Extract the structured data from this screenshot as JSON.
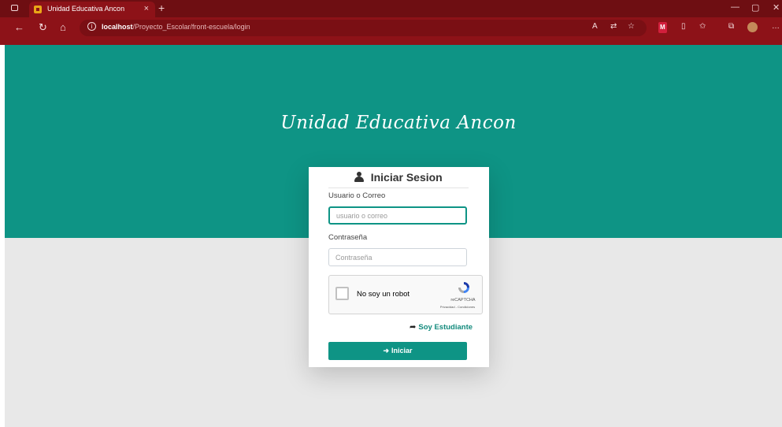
{
  "browser": {
    "tab_title": "Unidad Educativa Ancon",
    "tab_close": "×",
    "new_tab": "+",
    "url_host": "localhost",
    "url_path": "/Proyecto_Escolar/front-escuela/login",
    "toolbar_badge": "M",
    "window_controls": {
      "minimize": "—",
      "restore": "▢",
      "close": "✕"
    }
  },
  "page": {
    "school_name": "Unidad Educativa Ancon",
    "login": {
      "title": "Iniciar Sesion",
      "user_label": "Usuario o Correo",
      "user_placeholder": "usuario o correo",
      "password_label": "Contraseña",
      "password_placeholder": "Contraseña",
      "captcha_text": "No soy un robot",
      "captcha_brand": "reCAPTCHA",
      "captcha_links": "Privacidad - Condiciones",
      "student_link": "Soy Estudiante",
      "submit_label": "Iniciar"
    }
  },
  "colors": {
    "browser_frame": "#6e0e12",
    "hero_teal": "#0e9485",
    "page_gray": "#e8e8e8"
  },
  "icons": [
    "window-icon",
    "favicon",
    "back-arrow-icon",
    "refresh-icon",
    "home-icon",
    "info-icon",
    "read-aloud-icon",
    "translate-icon",
    "favorite-icon",
    "extension-icon",
    "split-screen-icon",
    "favorites-icon",
    "collections-icon",
    "profile-icon",
    "more-icon",
    "user-icon",
    "share-arrow-icon",
    "sign-in-icon",
    "recaptcha-logo"
  ]
}
